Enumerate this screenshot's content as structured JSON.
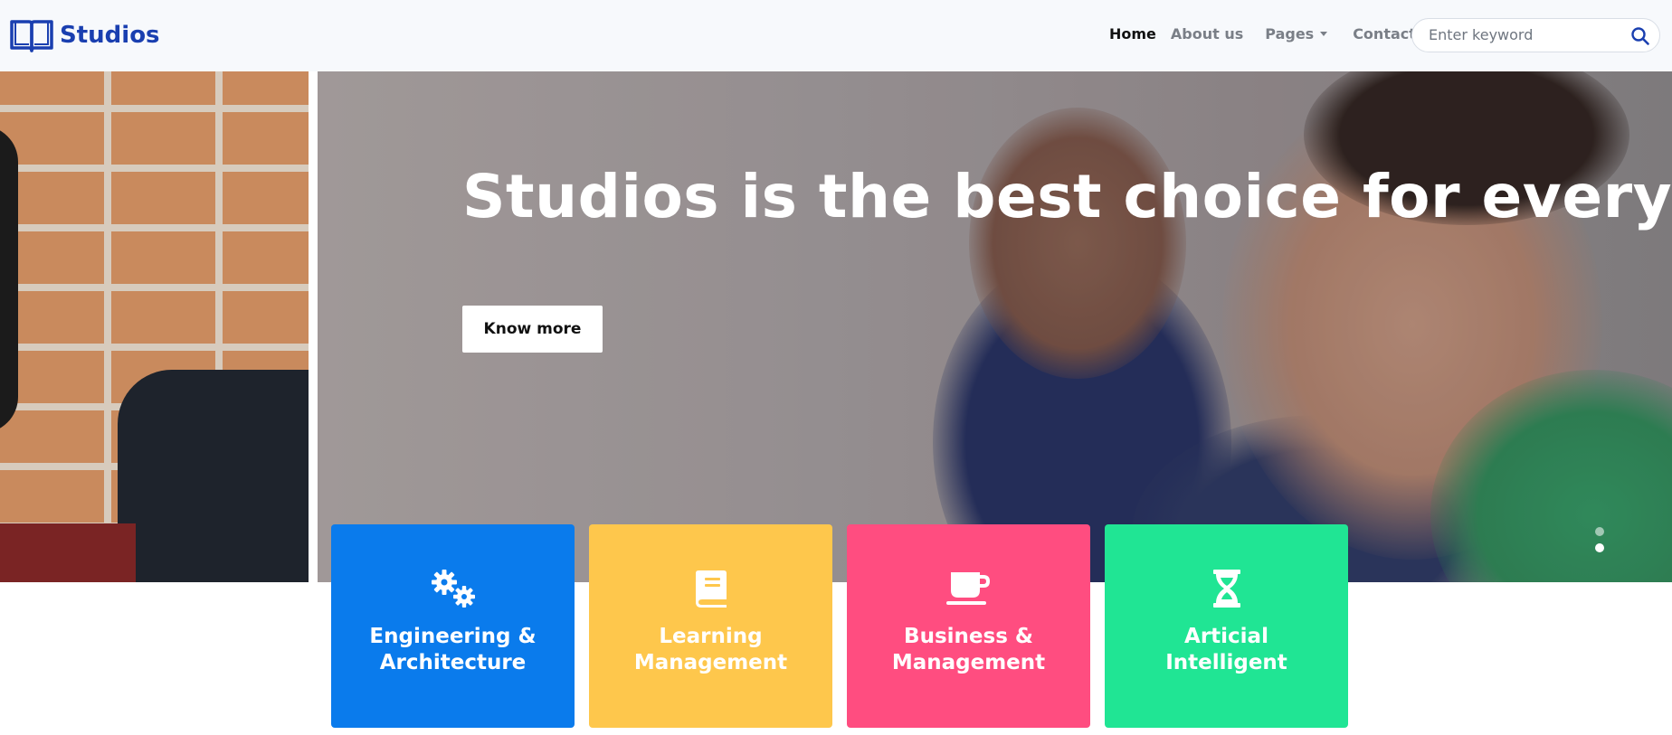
{
  "brand": {
    "name": "Studios",
    "icon": "open-book-icon"
  },
  "nav": {
    "home": "Home",
    "about": "About us",
    "pages": "Pages",
    "contacts": "Contacts"
  },
  "search": {
    "placeholder": "Enter keyword",
    "value": "",
    "icon": "search-icon"
  },
  "hero": {
    "title": "Studios is the best choice for everyone",
    "button": "Know more",
    "slide_count": 2,
    "active_slide": 2
  },
  "cards": [
    {
      "label_line1": "Engineering &",
      "label_line2": "Architecture",
      "icon": "gears-icon",
      "color": "#0a7bec"
    },
    {
      "label_line1": "Learning",
      "label_line2": "Management",
      "icon": "book-icon",
      "color": "#fec74c"
    },
    {
      "label_line1": "Business &",
      "label_line2": "Management",
      "icon": "coffee-cup-icon",
      "color": "#ff4d80"
    },
    {
      "label_line1": "Articial",
      "label_line2": "Intelligent",
      "icon": "hourglass-icon",
      "color": "#20e594"
    }
  ],
  "colors": {
    "brand": "#1a3fb0",
    "navbar_bg": "#f7f9fc"
  }
}
